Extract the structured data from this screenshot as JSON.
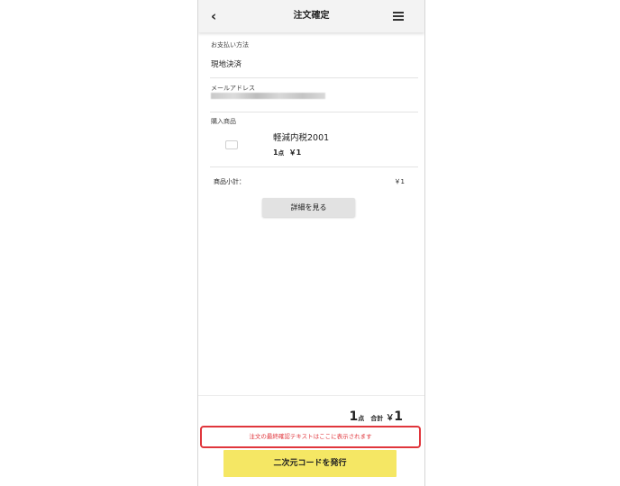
{
  "header": {
    "back_icon": "chevron-left-icon",
    "back_glyph": "‹",
    "title": "注文確定",
    "menu_icon": "hamburger-menu-icon"
  },
  "payment": {
    "label": "お支払い方法",
    "value": "現地決済"
  },
  "email": {
    "label": "メールアドレス",
    "value_obscured": true
  },
  "products": {
    "label": "購入商品",
    "image_icon": "product-image-placeholder-icon",
    "items": [
      {
        "name": "軽減内税2001",
        "qty": "1",
        "qty_unit": "点",
        "price": "￥1"
      }
    ]
  },
  "subtotal": {
    "label": "商品小計：",
    "value": "￥1"
  },
  "details_button": "詳細を見る",
  "total": {
    "qty": "1",
    "qty_unit": "点",
    "label": "合計",
    "yen": "￥",
    "amount": "1"
  },
  "final_confirmation_text": "注文の最終確認テキストはここに表示されます",
  "qr_button": "二次元コードを発行",
  "colors": {
    "header_bg": "#f3f3f3",
    "button_bg": "#e2e2e2",
    "qr_button_bg": "#f5e764",
    "alert_red": "#e0363c"
  }
}
